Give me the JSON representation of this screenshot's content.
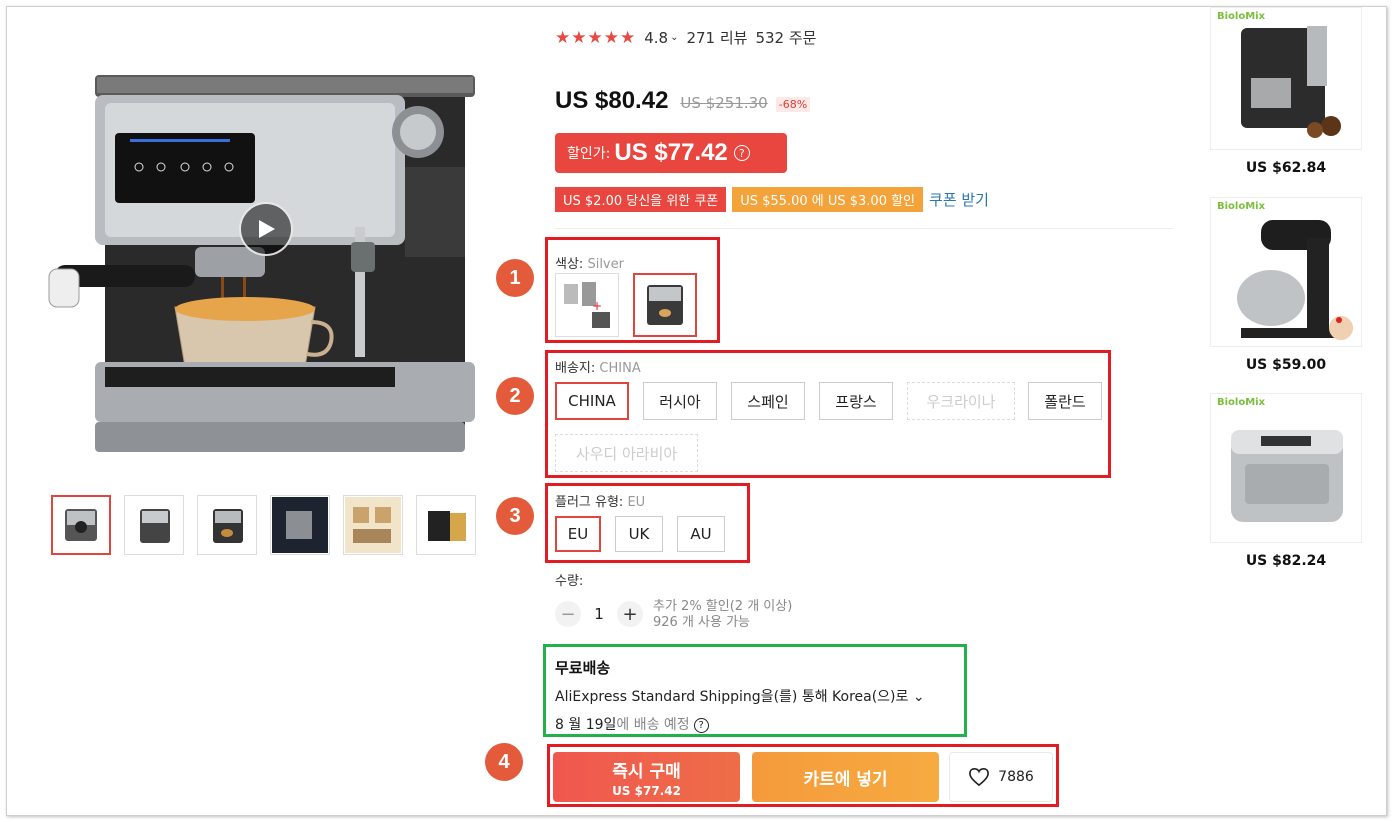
{
  "rating": {
    "stars": "★★★★★",
    "score": "4.8",
    "reviews": "271 리뷰",
    "orders": "532 주문"
  },
  "price": {
    "current": "US $80.42",
    "original": "US $251.30",
    "discount": "-68%"
  },
  "sale": {
    "label": "할인가:",
    "value": "US $77.42",
    "help": "?"
  },
  "coupons": {
    "coupon1": "US $2.00 당신을 위한 쿠폰",
    "coupon2": "US $55.00 에 US $3.00 할인",
    "link": "쿠폰 받기"
  },
  "color": {
    "label": "색상:",
    "value": "Silver"
  },
  "ship_from": {
    "label": "배송지:",
    "value": "CHINA",
    "options": [
      "CHINA",
      "러시아",
      "스페인",
      "프랑스",
      "우크라이나",
      "폴란드",
      "사우디 아라비아"
    ]
  },
  "plug": {
    "label": "플러그 유형:",
    "value": "EU",
    "options": [
      "EU",
      "UK",
      "AU"
    ]
  },
  "quantity": {
    "label": "수량:",
    "value": "1",
    "minus": "−",
    "plus": "+",
    "note1": "추가 2% 할인(2 개 이상)",
    "note2": "926 개 사용 가능"
  },
  "shipping": {
    "title": "무료배송",
    "method": "AliExpress Standard Shipping을(를) 통해 Korea(으)로 ⌄",
    "date": "8 월 19일",
    "date_suffix": "에 배송 예정",
    "help": "?"
  },
  "actions": {
    "buy_label": "즉시 구매",
    "buy_price": "US $77.42",
    "cart_label": "카트에 넣기",
    "wish_count": "7886"
  },
  "annotations": [
    "1",
    "2",
    "3",
    "4"
  ],
  "recommendations": [
    {
      "brand": "BioloMix",
      "price": "US $62.84"
    },
    {
      "brand": "BioloMix",
      "price": "US $59.00"
    },
    {
      "brand": "BioloMix",
      "price": "US $82.24"
    }
  ],
  "colors": {
    "accent": "#e8463e",
    "orange": "#f4a23a",
    "highlight_red": "#e31b23",
    "highlight_green": "#22b14c"
  }
}
